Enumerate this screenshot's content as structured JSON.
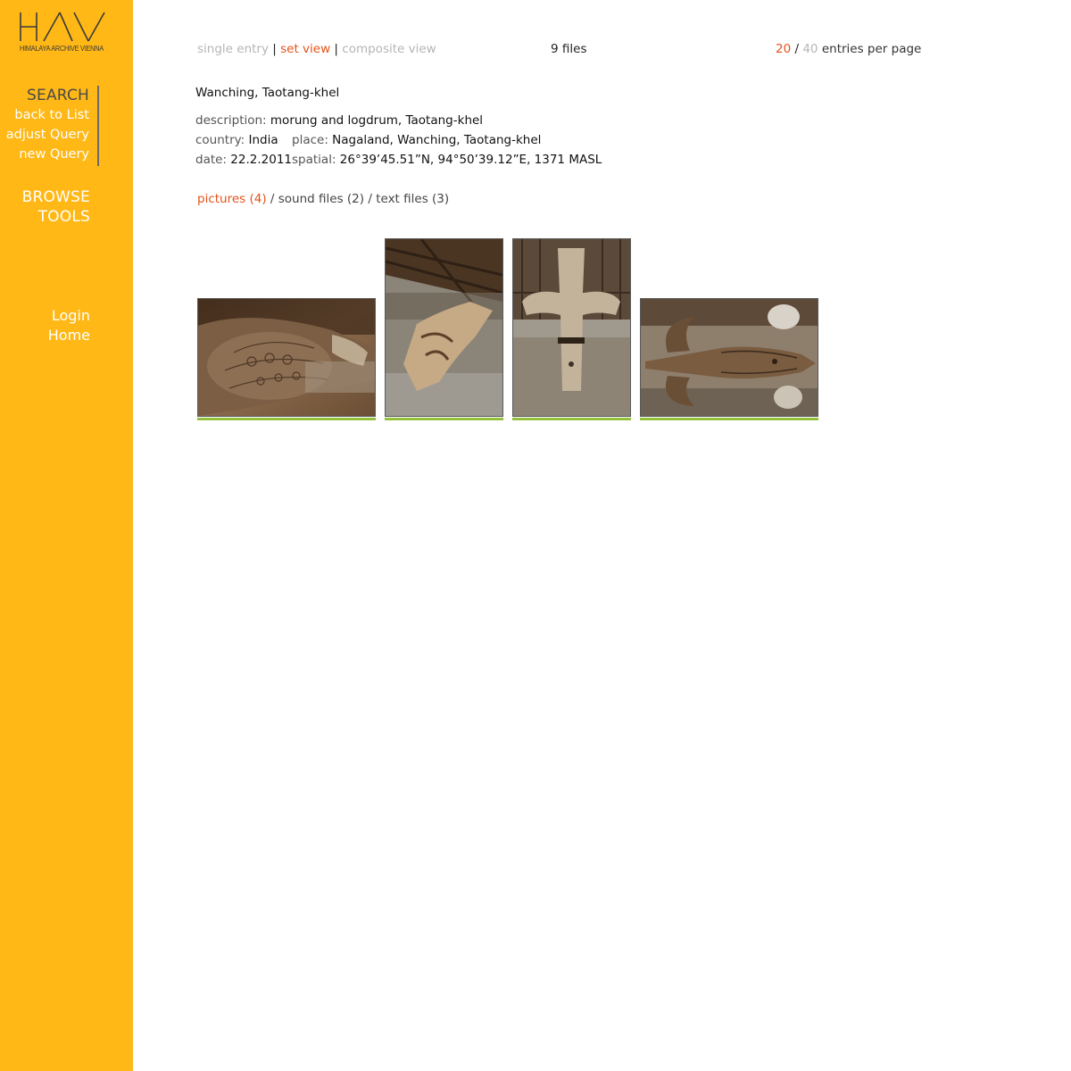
{
  "brand": {
    "logo_letters": "HAV",
    "logo_subtitle": "HIMALAYA ARCHIVE VIENNA",
    "sidebar_color": "#ffb816"
  },
  "sidebar": {
    "search_heading": "SEARCH",
    "search_links": [
      "back to List",
      "adjust Query",
      "new Query"
    ],
    "browse_heading": "BROWSE",
    "tools_heading": "TOOLS",
    "account_links": [
      "Login",
      "Home"
    ]
  },
  "view_switch": {
    "single_entry": "single entry",
    "set_view": "set view",
    "composite_view": "composite view",
    "separator": "|",
    "active": "set view"
  },
  "file_count": "9 files",
  "paging": {
    "option_20": "20",
    "option_40": "40",
    "separator": "/",
    "suffix": "entries per page",
    "selected": "20"
  },
  "entry": {
    "title": "Wanching, Taotang-khel",
    "description_label": "description:",
    "description": "morung and logdrum, Taotang-khel",
    "country_label": "country:",
    "country": "India",
    "place_label": "place:",
    "place": "Nagaland, Wanching, Taotang-khel",
    "date_label": "date:",
    "date": "22.2.2011",
    "spatial_label": "spatial:",
    "spatial": "26°39’45.51”N, 94°50’39.12”E, 1371 MASL"
  },
  "file_tabs": {
    "pictures": "pictures (4)",
    "sound": "sound files (2)",
    "text": "text files (3)",
    "separator": "/",
    "active": "pictures"
  },
  "thumbnails": [
    {
      "subject": "carved logdrum end with geometric pattern",
      "orientation": "landscape"
    },
    {
      "subject": "carved wooden figure under roof beams",
      "orientation": "portrait"
    },
    {
      "subject": "carved post with crossbar",
      "orientation": "portrait"
    },
    {
      "subject": "carved wooden hornbill head",
      "orientation": "landscape"
    }
  ],
  "colors": {
    "accent": "#e5531a",
    "muted": "#b5b5b5",
    "thumb_underline": "#93c13c"
  }
}
